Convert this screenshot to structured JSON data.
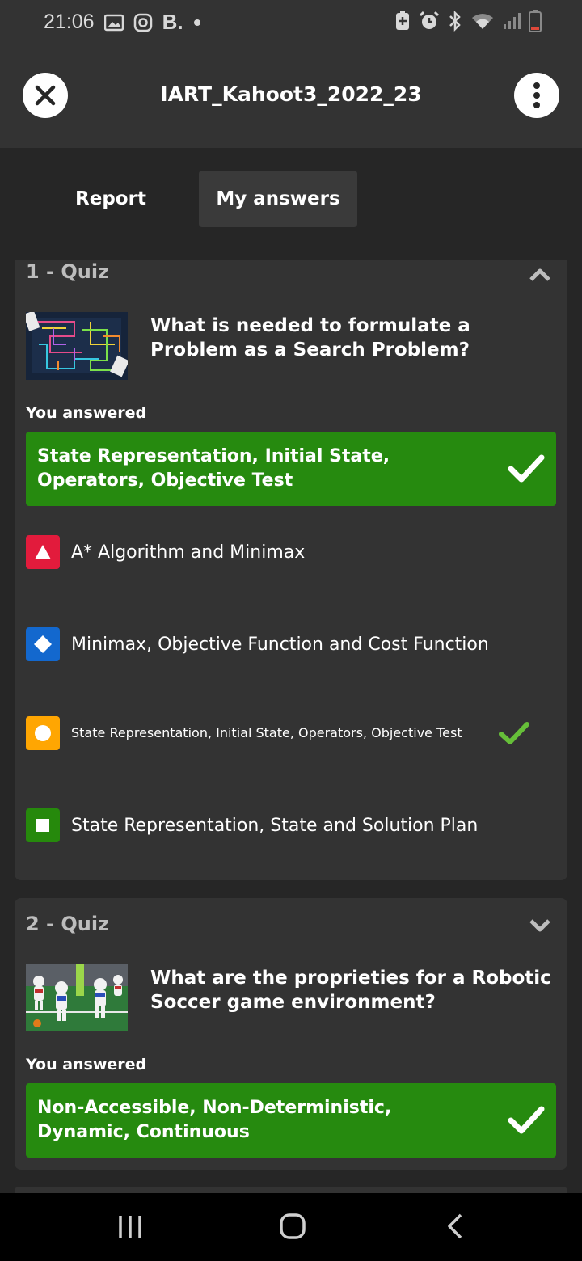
{
  "status_bar": {
    "time": "21:06",
    "left_icons": [
      "gallery-icon",
      "instagram-icon",
      "b-app-icon",
      "dot-icon"
    ],
    "b_label": "B.",
    "right_icons": [
      "battery-saver-icon",
      "alarm-icon",
      "bluetooth-icon",
      "wifi-icon",
      "signal-icon",
      "battery-low-icon"
    ]
  },
  "header": {
    "title": "IART_Kahoot3_2022_23",
    "close_icon": "close-icon",
    "menu_icon": "more-vertical-icon"
  },
  "tabs": [
    {
      "label": "Report",
      "active": false
    },
    {
      "label": "My answers",
      "active": true
    }
  ],
  "colors": {
    "background": "#262626",
    "card": "#333333",
    "correct_green": "#268a0f",
    "red": "#e21b3c",
    "blue": "#1368ce",
    "yellow": "#ffa602",
    "green": "#26890c",
    "check_green": "#66bf39"
  },
  "quizzes": [
    {
      "heading": "1 - Quiz",
      "expanded": true,
      "question": "What is needed to formulate a Problem as a Search Problem?",
      "you_answered_label": "You answered",
      "answer": "State Representation, Initial State, Operators, Objective Test",
      "answer_correct": true,
      "options": [
        {
          "shape": "triangle",
          "text": "A* Algorithm and Minimax",
          "correct": false
        },
        {
          "shape": "diamond",
          "text": "Minimax, Objective Function and Cost Function",
          "correct": false
        },
        {
          "shape": "circle",
          "text": "State Representation, Initial State, Operators, Objective Test",
          "correct": true
        },
        {
          "shape": "square",
          "text": "State Representation, State and Solution Plan",
          "correct": false
        }
      ]
    },
    {
      "heading": "2 - Quiz",
      "expanded": false,
      "question": "What are the proprieties for a Robotic Soccer game environment?",
      "you_answered_label": "You answered",
      "answer": "Non-Accessible, Non-Deterministic, Dynamic, Continuous",
      "answer_correct": true
    }
  ],
  "nav_bar": {
    "icons": [
      "recent-apps-icon",
      "home-icon",
      "back-icon"
    ]
  }
}
